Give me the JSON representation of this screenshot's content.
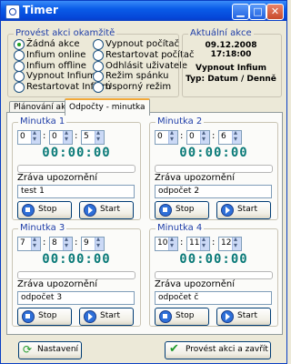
{
  "window": {
    "title": "Timer"
  },
  "akce": {
    "title": "Provést akci okamžitě",
    "left": [
      "Žádná akce",
      "Infium online",
      "Infium offline",
      "Vypnout Infium",
      "Restartovat Infium"
    ],
    "right": [
      "Vypnout počítač",
      "Restartovat počítač",
      "Odhlásit uživatele",
      "Režim spánku",
      "Úsporný režim"
    ],
    "selected": "Žádná akce"
  },
  "aktualni": {
    "title": "Aktuální akce",
    "datetime": "09.12.2008 17:18:00",
    "action_line1": "Vypnout Infium",
    "action_line2": "Typ: Datum / Denně"
  },
  "tabs": [
    "Plánování akcí",
    "Odpočty - minutka"
  ],
  "minutky": [
    {
      "title": "Minutka 1",
      "h": "0",
      "m": "0",
      "s": "5",
      "display": "00:00:00",
      "zprava_label": "Zráva upozornění",
      "zprava": "test 1",
      "stop": "Stop",
      "start": "Start"
    },
    {
      "title": "Minutka 2",
      "h": "0",
      "m": "0",
      "s": "6",
      "display": "00:00:00",
      "zprava_label": "Zráva upozornění",
      "zprava": "odpočet 2",
      "stop": "Stop",
      "start": "Start"
    },
    {
      "title": "Minutka 3",
      "h": "7",
      "m": "8",
      "s": "9",
      "display": "00:00:00",
      "zprava_label": "Zráva upozornění",
      "zprava": "odpočet 3",
      "stop": "Stop",
      "start": "Start"
    },
    {
      "title": "Minutka 4",
      "h": "10",
      "m": "11",
      "s": "12",
      "display": "00:00:00",
      "zprava_label": "Zráva upozornění",
      "zprava": "odpočet č",
      "stop": "Stop",
      "start": "Start"
    }
  ],
  "buttons": {
    "nastaveni": "Nastavení",
    "provest": "Provést akci a zavřít"
  }
}
